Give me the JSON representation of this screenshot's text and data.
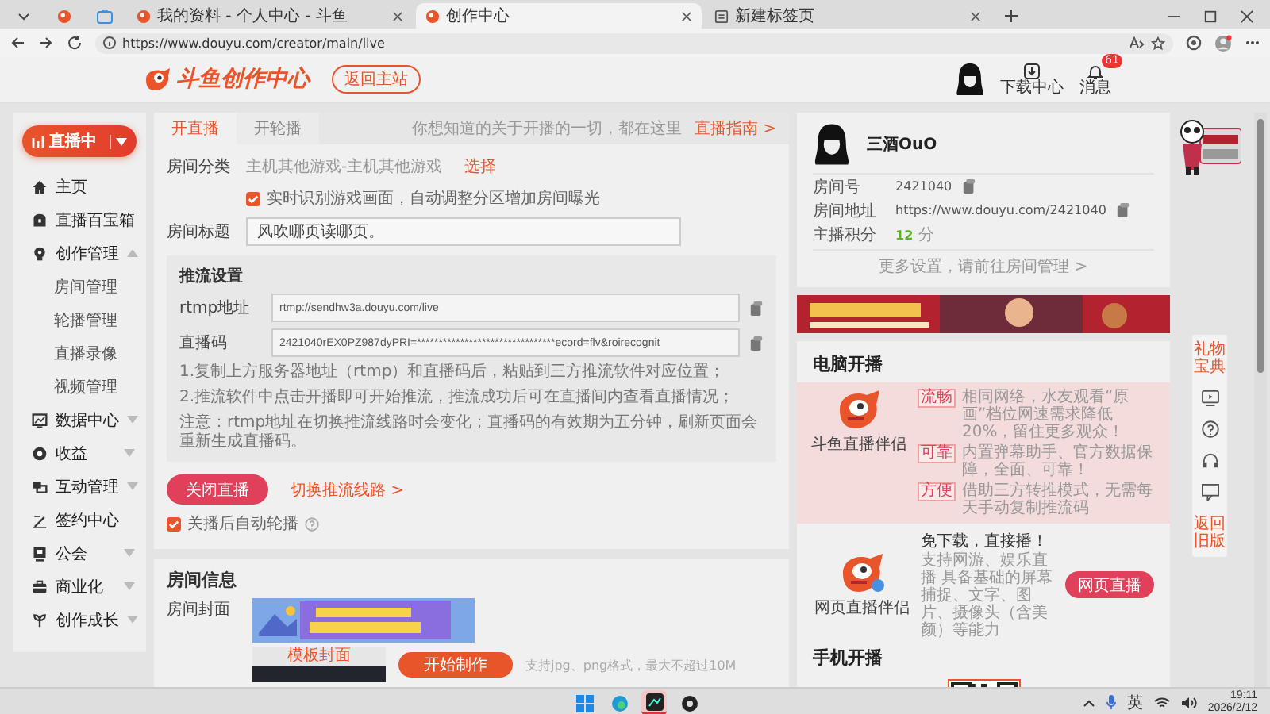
{
  "browser": {
    "tabs": [
      {
        "title": "我的资料 - 个人中心 - 斗鱼",
        "selected": false
      },
      {
        "title": "创作中心",
        "selected": true
      },
      {
        "title": "新建标签页",
        "selected": false
      }
    ],
    "url": "https://www.douyu.com/creator/main/live"
  },
  "site_header": {
    "logo": "斗鱼创作中心",
    "back_button": "返回主站",
    "download": "下载中心",
    "messages": "消息",
    "message_count": "61"
  },
  "sidebar": {
    "live_button": "直播中",
    "items": [
      {
        "label": "主页",
        "kind": "link"
      },
      {
        "label": "直播百宝箱",
        "kind": "link"
      },
      {
        "label": "创作管理",
        "kind": "group",
        "expanded": true,
        "children": [
          {
            "label": "房间管理"
          },
          {
            "label": "轮播管理"
          },
          {
            "label": "直播录像"
          },
          {
            "label": "视频管理"
          }
        ]
      },
      {
        "label": "数据中心",
        "kind": "group",
        "expanded": false
      },
      {
        "label": "收益",
        "kind": "group",
        "expanded": false
      },
      {
        "label": "互动管理",
        "kind": "group",
        "expanded": false
      },
      {
        "label": "签约中心",
        "kind": "link"
      },
      {
        "label": "公会",
        "kind": "group",
        "expanded": false
      },
      {
        "label": "商业化",
        "kind": "group",
        "expanded": false
      },
      {
        "label": "创作成长",
        "kind": "group",
        "expanded": false
      }
    ]
  },
  "live_panel": {
    "tabs": [
      {
        "label": "开直播",
        "selected": true
      },
      {
        "label": "开轮播",
        "selected": false
      }
    ],
    "hint": "你想知道的关于开播的一切，都在这里",
    "guide_link": "直播指南 >",
    "category": {
      "label": "房间分类",
      "value": "主机其他游戏-主机其他游戏",
      "action": "选择"
    },
    "auto_detect": {
      "label": "实时识别游戏画面，自动调整分区增加房间曝光",
      "checked": true
    },
    "room_title": {
      "label": "房间标题",
      "value": "风吹哪页读哪页。"
    },
    "push_settings": {
      "title": "推流设置",
      "fields": [
        {
          "label": "rtmp地址",
          "value": "rtmp://sendhw3a.douyu.com/live"
        },
        {
          "label": "直播码",
          "value": "2421040rEX0PZ987dyPRI=********************************ecord=flv&roirecognit"
        }
      ],
      "notes": [
        "1.复制上方服务器地址（rtmp）和直播码后，粘贴到三方推流软件对应位置；",
        "2.推流软件中点击开播即可开始推流，推流成功后可在直播间内查看直播情况；",
        "注意：rtmp地址在切换推流线路时会变化；直播码的有效期为五分钟，刷新页面会重新生成直播码。"
      ]
    },
    "stop_button": "关闭直播",
    "switch_link": "切换推流线路 >",
    "auto_rotate": {
      "label": "关播后自动轮播",
      "checked": true
    }
  },
  "room_info": {
    "title": "房间信息",
    "cover_label": "房间封面",
    "template_label": "模板封面",
    "make_button": "开始制作",
    "format_note": "支持jpg、png格式，最大不超过10M"
  },
  "room_card": {
    "name": "三酒OuO",
    "rows": [
      {
        "label": "房间号",
        "value": "2421040",
        "kind": "copy"
      },
      {
        "label": "房间地址",
        "value": "https://www.douyu.com/2421040",
        "kind": "copy"
      },
      {
        "label": "主播积分",
        "value": "12",
        "unit": "分",
        "kind": "score"
      }
    ],
    "more_link": "更多设置，请前往房间管理 >"
  },
  "pc_live": {
    "title": "电脑开播",
    "app_name": "斗鱼直播伴侣",
    "features": [
      {
        "tag": "流畅",
        "text": "相同网络，水友观看“原画”档位网速需求降低20%，留住更多观众！"
      },
      {
        "tag": "可靠",
        "text": "内置弹幕助手、官方数据保障，全面、可靠！"
      },
      {
        "tag": "方便",
        "text": "借助三方转推模式，无需每天手动复制推流码"
      }
    ],
    "web_app_name": "网页直播伴侣",
    "web_title": "免下载，直接播！",
    "web_text": "支持网游、娱乐直播 具备基础的屏幕捕捉、文字、图片、摄像头（含美颜）等能力",
    "web_button": "网页直播"
  },
  "mobile_live": {
    "title": "手机开播"
  },
  "side_tools": {
    "top_link": "礼物宝典",
    "bottom_link": "返回旧版"
  },
  "taskbar": {
    "input_method": "英",
    "time": "19:11",
    "date": "2026/2/12"
  }
}
